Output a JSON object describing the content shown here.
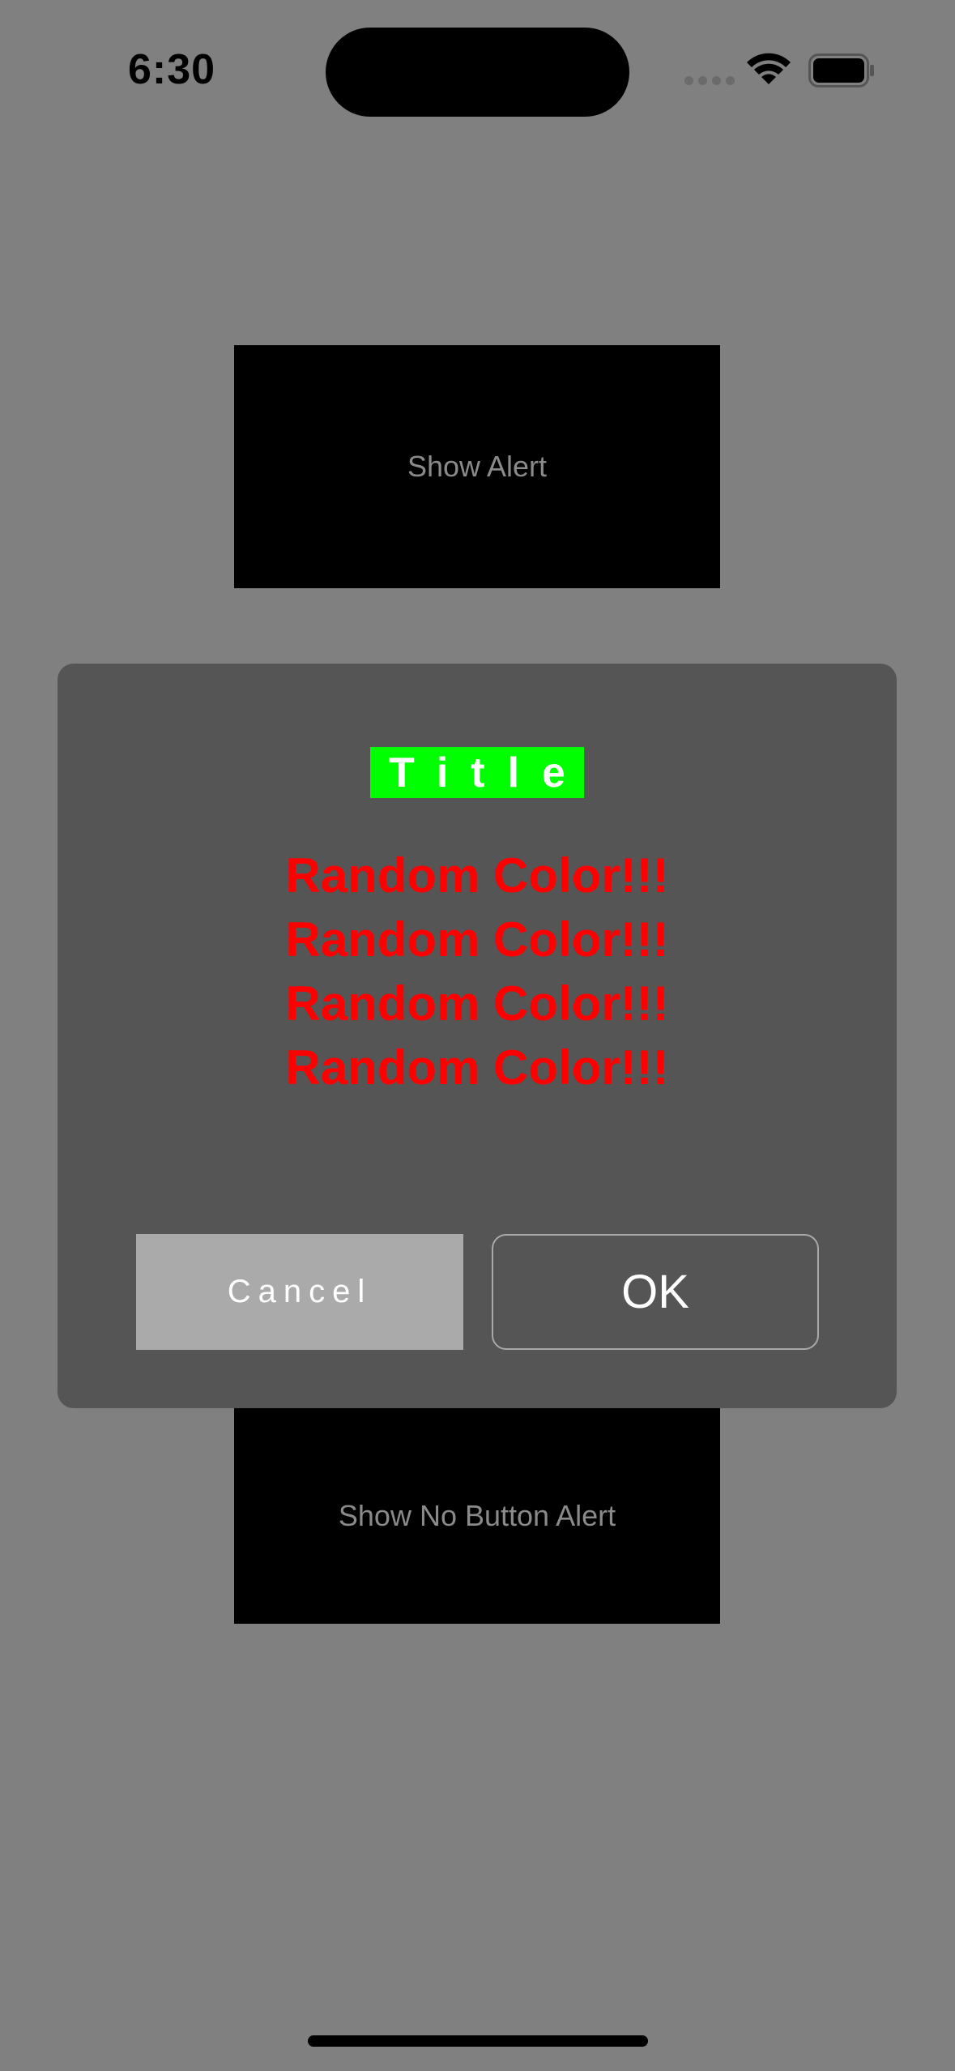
{
  "status_bar": {
    "time": "6:30",
    "icons": [
      "cellular-signal-icon",
      "wifi-icon",
      "battery-icon"
    ]
  },
  "background": {
    "show_alert_label": "Show Alert",
    "show_no_button_alert_label": "Show No Button Alert"
  },
  "alert": {
    "title": "Title",
    "message_lines": [
      "Random Color!!!",
      "Random Color!!!",
      "Random Color!!!",
      "Random Color!!!"
    ],
    "cancel_label": "Cancel",
    "ok_label": "OK"
  },
  "colors": {
    "page_background": "#808080",
    "alert_background": "#555555",
    "title_background": "#00ff00",
    "message_text": "#ff0000",
    "cancel_background": "#aaaaaa"
  }
}
